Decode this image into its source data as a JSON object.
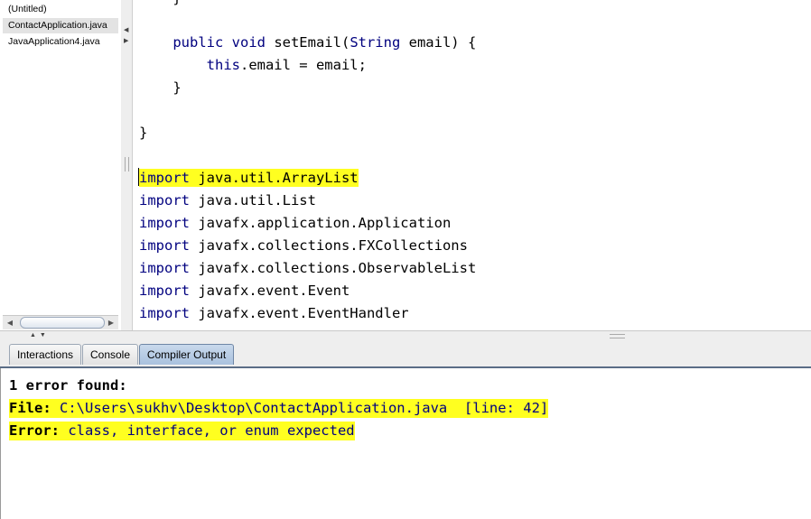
{
  "files": {
    "items": [
      {
        "label": "(Untitled)",
        "selected": false
      },
      {
        "label": "ContactApplication.java",
        "selected": true
      },
      {
        "label": "JavaApplication4.java",
        "selected": false
      }
    ]
  },
  "editor": {
    "lines": [
      {
        "text": "    }"
      },
      {
        "kw": "    public void ",
        "rest": "setEmail(",
        "kw2": "String",
        "rest2": " email) {"
      },
      {
        "kw": "        this",
        "rest": ".email = email;"
      },
      {
        "text": "    }"
      },
      {
        "text": "}"
      },
      {
        "kw": "import ",
        "rest": "java.util.ArrayList"
      },
      {
        "kw": "import ",
        "rest": "java.util.List"
      },
      {
        "kw": "import ",
        "rest": "javafx.application.Application"
      },
      {
        "kw": "import ",
        "rest": "javafx.collections.FXCollections"
      },
      {
        "kw": "import ",
        "rest": "javafx.collections.ObservableList"
      },
      {
        "kw": "import ",
        "rest": "javafx.event.Event"
      },
      {
        "kw": "import ",
        "rest": "javafx.event.EventHandler"
      }
    ]
  },
  "tabs": [
    {
      "label": "Interactions",
      "active": false
    },
    {
      "label": "Console",
      "active": false
    },
    {
      "label": "Compiler Output",
      "active": true
    }
  ],
  "output": {
    "summary": "1 error found:",
    "file_label": "File:",
    "file_value": " C:\\Users\\sukhv\\Desktop\\ContactApplication.java  [line: 42]",
    "error_label": "Error:",
    "error_value": " class, interface, or enum expected"
  },
  "colors": {
    "highlight": "#ffff20",
    "keyword": "#00007f",
    "active_tab": "#a9c1de"
  }
}
